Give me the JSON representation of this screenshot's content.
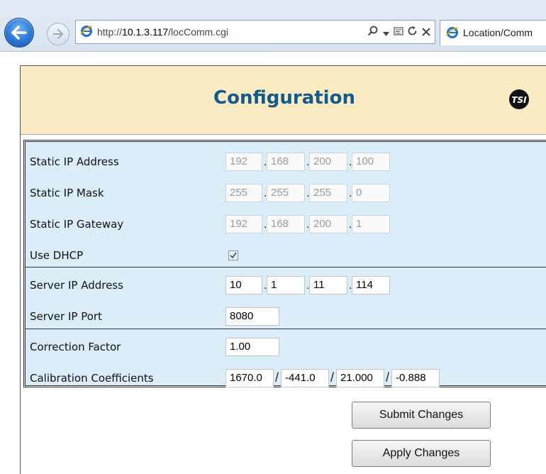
{
  "browser": {
    "url_prefix": "http://",
    "url_host": "10.1.3.117",
    "url_path": "/locComm.cgi",
    "tab_title": "Location/Comm",
    "search_icon": "search-icon",
    "dropdown_icon": "chevron-down-icon"
  },
  "page": {
    "title": "Configuration",
    "logo": "TSI"
  },
  "form": {
    "static_ip_label": "Static IP Address",
    "static_ip": [
      "192",
      "168",
      "200",
      "100"
    ],
    "static_mask_label": "Static IP Mask",
    "static_mask": [
      "255",
      "255",
      "255",
      "0"
    ],
    "static_gateway_label": "Static IP Gateway",
    "static_gateway": [
      "192",
      "168",
      "200",
      "1"
    ],
    "dhcp_label": "Use DHCP",
    "dhcp_checked": true,
    "server_ip_label": "Server IP Address",
    "server_ip": [
      "10",
      "1",
      "11",
      "114"
    ],
    "server_port_label": "Server IP Port",
    "server_port": "8080",
    "correction_label": "Correction Factor",
    "correction_value": "1.00",
    "calibration_label": "Calibration Coefficients",
    "calibration": [
      "1670.0",
      "-441.0",
      "21.000",
      "-0.888"
    ],
    "octet_separator": ".",
    "coef_separator": "/"
  },
  "buttons": {
    "submit": "Submit Changes",
    "apply": "Apply Changes"
  },
  "colors": {
    "title": "#125a8c",
    "header_bg": "#fbebc3",
    "form_bg": "#daedf9"
  }
}
